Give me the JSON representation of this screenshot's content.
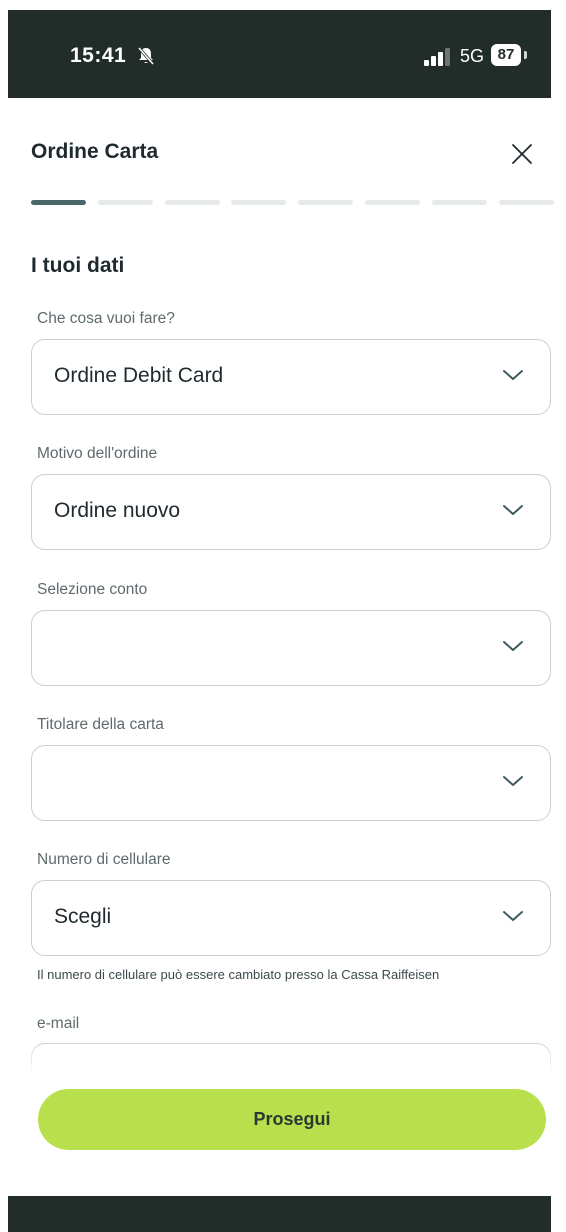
{
  "status_bar": {
    "time": "15:41",
    "network": "5G",
    "battery": "87"
  },
  "header": {
    "title": "Ordine Carta"
  },
  "stepper": {
    "total_steps": 8,
    "current_step": 1
  },
  "form": {
    "section_title": "I tuoi dati",
    "fields": [
      {
        "label": "Che cosa vuoi fare?",
        "value": "Ordine Debit Card"
      },
      {
        "label": "Motivo dell'ordine",
        "value": "Ordine nuovo"
      },
      {
        "label": "Selezione conto",
        "value": ""
      },
      {
        "label": "Titolare della carta",
        "value": ""
      },
      {
        "label": "Numero di cellulare",
        "value": "Scegli",
        "hint": "Il numero di cellulare può essere cambiato presso la Cassa Raiffeisen"
      },
      {
        "label": "e-mail",
        "value": ""
      }
    ]
  },
  "actions": {
    "continue_label": "Prosegui"
  },
  "colors": {
    "accent": "#b8e04c",
    "dark": "#222d29",
    "stepper_active": "#4c676c"
  }
}
